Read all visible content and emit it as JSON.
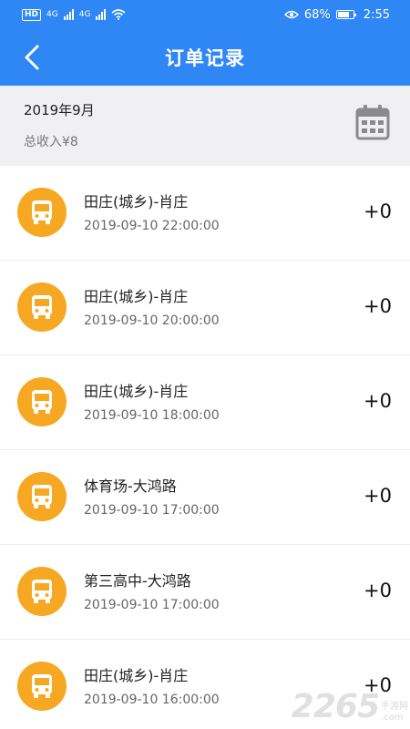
{
  "status_bar": {
    "network_badge": "HD",
    "signal1": "4G",
    "signal2": "4G",
    "battery": "68%",
    "time": "2:55"
  },
  "header": {
    "title": "订单记录",
    "back_icon": "chevron-left-icon"
  },
  "summary": {
    "month": "2019年9月",
    "income": "总收入¥8",
    "calendar_icon": "calendar-icon"
  },
  "orders": [
    {
      "route": "田庄(城乡)-肖庄",
      "time": "2019-09-10 22:00:00",
      "amount": "+0"
    },
    {
      "route": "田庄(城乡)-肖庄",
      "time": "2019-09-10 20:00:00",
      "amount": "+0"
    },
    {
      "route": "田庄(城乡)-肖庄",
      "time": "2019-09-10 18:00:00",
      "amount": "+0"
    },
    {
      "route": "体育场-大鸿路",
      "time": "2019-09-10 17:00:00",
      "amount": "+0"
    },
    {
      "route": "第三高中-大鸿路",
      "time": "2019-09-10 17:00:00",
      "amount": "+0"
    },
    {
      "route": "田庄(城乡)-肖庄",
      "time": "2019-09-10 16:00:00",
      "amount": "+0"
    }
  ],
  "watermark": {
    "number": "2265",
    "line1": "手游网",
    "line2": ".com"
  },
  "colors": {
    "primary": "#2f86f5",
    "bus_icon_bg": "#f7a823",
    "summary_bg": "#f0f0f2"
  }
}
